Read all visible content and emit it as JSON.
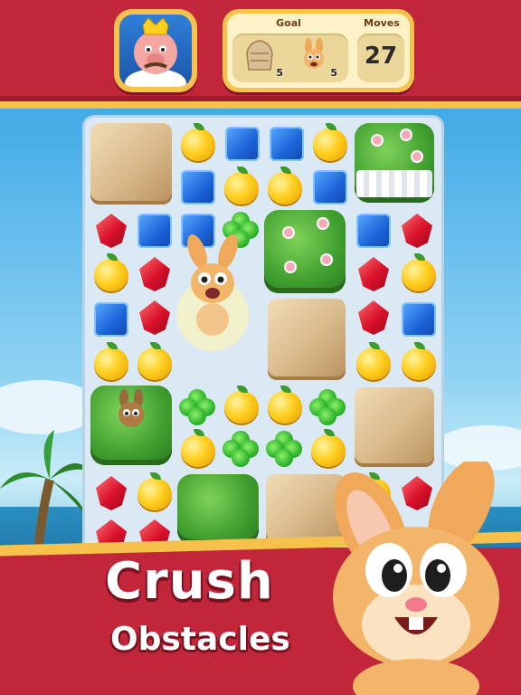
{
  "header": {
    "goal_label": "Goal",
    "moves_label": "Moves",
    "moves_value": "27",
    "goals": [
      {
        "icon": "rock-statue-icon",
        "count": "5"
      },
      {
        "icon": "bunny-icon",
        "count": "5"
      }
    ]
  },
  "banner": {
    "line1": "Crush",
    "line2": "Obstacles"
  },
  "colors": {
    "header_red": "#c1263a",
    "gold": "#f6c24b",
    "board_bg": "#dbe9f5"
  }
}
